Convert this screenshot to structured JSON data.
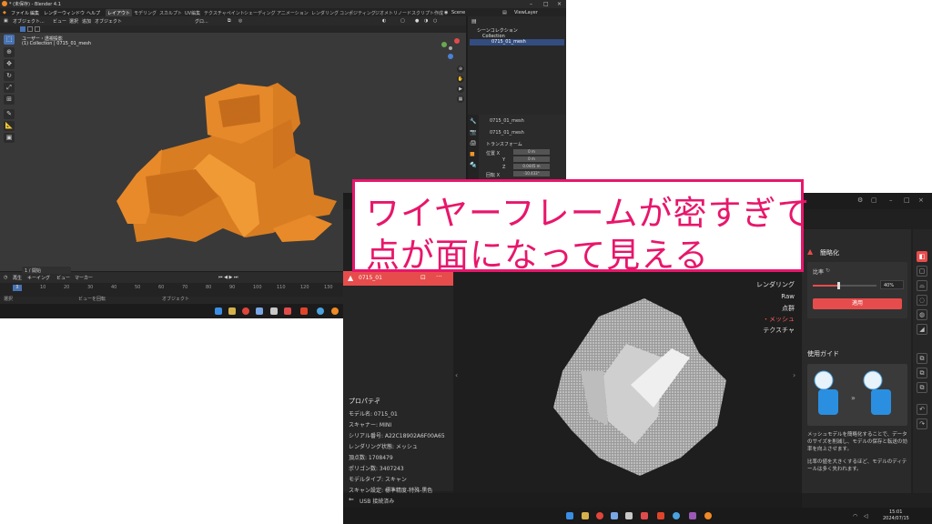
{
  "blender": {
    "title": "* (未保存) - Blender 4.1",
    "menus": [
      "ファイル",
      "編集",
      "レンダー",
      "ウィンドウ",
      "ヘルプ"
    ],
    "workspaces": [
      "レイアウト",
      "モデリング",
      "スカルプト",
      "UV編集",
      "テクスチャペイント",
      "シェーディング",
      "アニメーション",
      "レンダリング",
      "コンポジティング",
      "ジオメトリノード",
      "スクリプト作成"
    ],
    "active_workspace_index": 0,
    "scene": "Scene",
    "view_layer": "ViewLayer",
    "viewport": {
      "mode": "オブジェクト...",
      "menus": [
        "ビュー",
        "選択",
        "追加",
        "オブジェクト"
      ],
      "transform": "グロ...",
      "info_line1": "ユーザー・透視投影",
      "info_line2": "(1) Collection | 0715_01_mesh",
      "mesh_color": "#f0952a",
      "background_color": "#393939"
    },
    "outliner": {
      "root": "シーンコレクション",
      "collection": "Collection",
      "object": "0715_01_mesh"
    },
    "properties": {
      "object_name": "0715_01_mesh",
      "data_name": "0715_01_mesh",
      "section": "トランスフォーム",
      "rows": [
        {
          "label": "位置 X",
          "value": "0 m"
        },
        {
          "label": "Y",
          "value": "0 m"
        },
        {
          "label": "Z",
          "value": "0.0445 m"
        },
        {
          "label": "回転 X",
          "value": "-10.433°"
        }
      ]
    },
    "timeline": {
      "menus": [
        "再生",
        "キーイング",
        "ビュー",
        "マーカー"
      ],
      "current_frame": "1",
      "ticks": [
        "1",
        "10",
        "20",
        "30",
        "40",
        "50",
        "60",
        "70",
        "80",
        "90",
        "100",
        "110",
        "120",
        "130",
        "140",
        "150",
        "160",
        "170",
        "180"
      ]
    },
    "status": {
      "select": "選択",
      "rotate": "ビューを回転",
      "object": "オブジェクト",
      "frame_label": "1 / 開始"
    }
  },
  "scanner": {
    "left_header": "0715_01",
    "properties_title": "プロパティ",
    "properties": [
      "モデル名:  0715_01",
      "スキャナー:  MINI",
      "シリアル番号:  A22C18902A6F00A65",
      "レンダリング状態:  メッシュ",
      "頂点数:  1708479",
      "ポリゴン数:  3407243",
      "モデルタイプ:  スキャン",
      "スキャン設定:  標準精度-特殊-黒色"
    ],
    "render_title": "レンダリング",
    "render_options": [
      "Raw",
      "点群",
      "・メッシュ",
      "テクスチャ"
    ],
    "selected_render_index": 2,
    "simplify": {
      "title": "簡略化",
      "ratio_label": "比率",
      "percent": "40%",
      "slider_fraction": 0.4,
      "apply_button": "適用"
    },
    "guide": {
      "title": "使用ガイド",
      "text1": "メッシュモデルを簡略化することで、データのサイズを削減し、モデルの保存と転送の効率を向上させます。",
      "text2": "比率の値を大きくするほど、モデルのディテールは多く失われます。"
    },
    "usb": "USB 接続済み",
    "clock_time": "15:01",
    "clock_date": "2024/07/15",
    "accent": "#e74c4c"
  },
  "annotation": {
    "line1": "ワイヤーフレームが密すぎて",
    "line2": "点が面になって見える",
    "border_color": "#e8166b"
  }
}
